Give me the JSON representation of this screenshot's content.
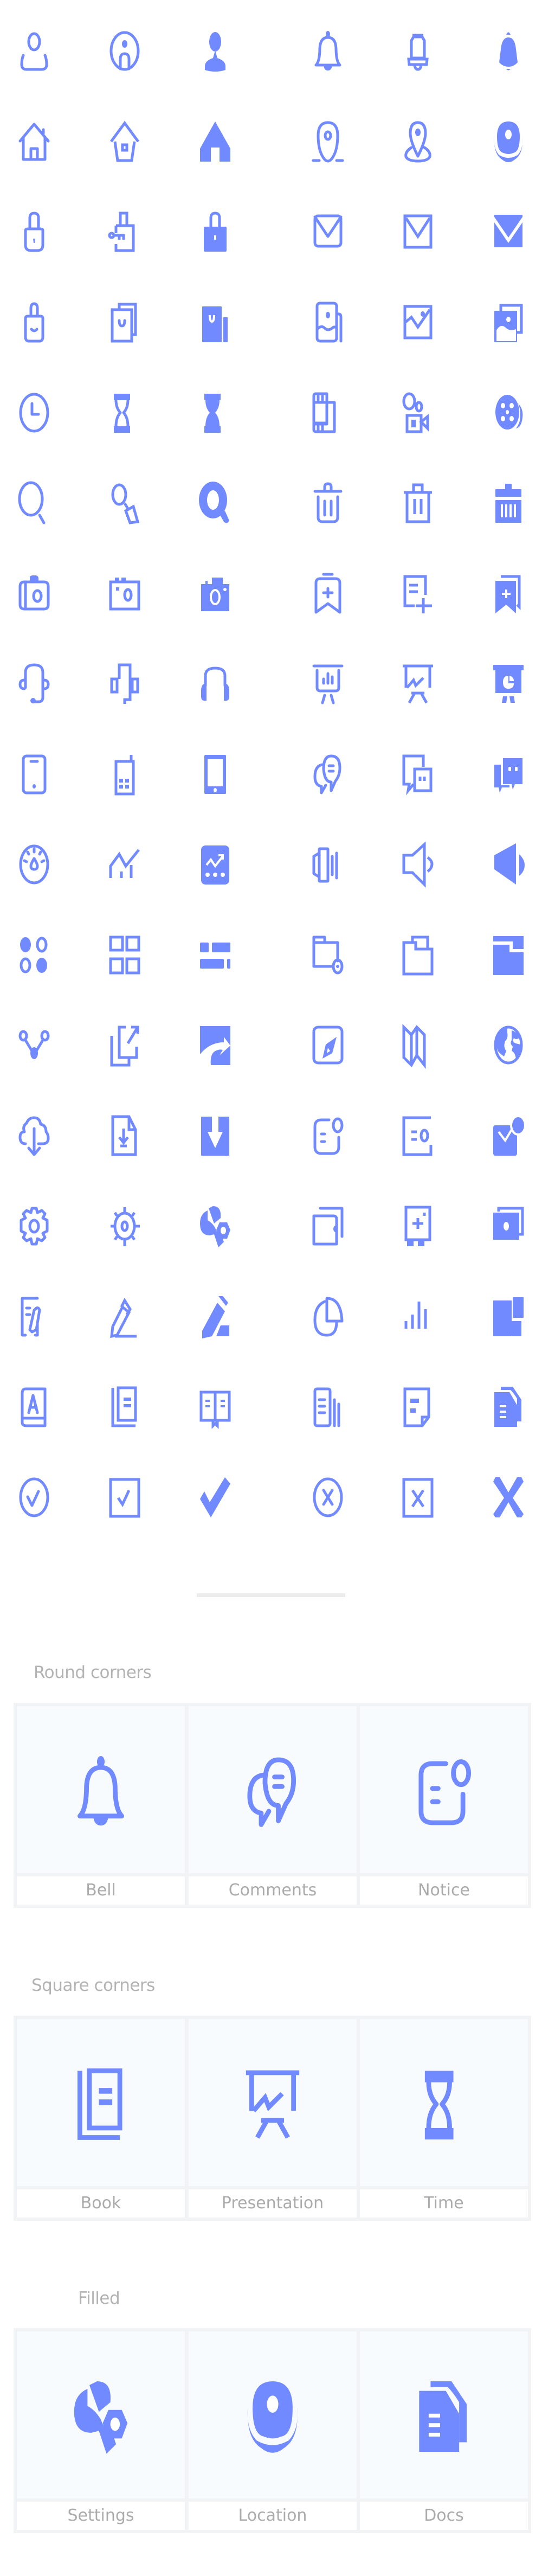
{
  "accent_color": "#728aff",
  "icon_grid": {
    "rows": [
      [
        "user-outline",
        "user-circle",
        "user-filled",
        "bell-round",
        "bell-square",
        "bell-filled"
      ],
      [
        "home-round",
        "home-square",
        "home-filled",
        "location-round",
        "location-square",
        "location-filled"
      ],
      [
        "lock-round",
        "lock-key-square",
        "lock-filled",
        "mail-round",
        "mail-square",
        "mail-filled"
      ],
      [
        "shopping-bag-round",
        "shopping-bag-square",
        "shopping-bag-filled",
        "image-round",
        "image-square",
        "image-filled"
      ],
      [
        "clock-round",
        "hourglass-square",
        "hourglass-filled",
        "film-round",
        "video-camera-square",
        "film-reel-filled"
      ],
      [
        "search-round",
        "search-square",
        "search-filled",
        "trash-round",
        "trash-square",
        "trash-filled"
      ],
      [
        "camera-round",
        "camera-square",
        "camera-filled",
        "bookmark-add-round",
        "note-add-square",
        "bookmark-add-filled"
      ],
      [
        "headset-round",
        "headset-square",
        "headphones-filled",
        "presentation-round",
        "presentation-square",
        "presentation-filled"
      ],
      [
        "smartphone-round",
        "mobile-phone-square",
        "smartphone-filled",
        "comments-round",
        "comments-square",
        "comments-filled"
      ],
      [
        "gauge-round",
        "line-chart-square",
        "analytics-filled",
        "volume-round",
        "volume-square",
        "volume-filled"
      ],
      [
        "dots-grid-round",
        "grid-square",
        "list-filled",
        "folder-settings-round",
        "folder-square",
        "folder-filled"
      ],
      [
        "share-round",
        "external-link-square",
        "share-filled",
        "compass-round",
        "map-square",
        "globe-filled"
      ],
      [
        "cloud-download-round",
        "file-download-square",
        "download-filled",
        "notice-round",
        "notice-square",
        "notice-filled"
      ],
      [
        "settings-round",
        "settings-square",
        "settings-filled",
        "wallet-round",
        "safe-square",
        "money-filled"
      ],
      [
        "edit-document-round",
        "pencil-square",
        "pencil-filled",
        "pie-chart-round",
        "bar-chart-square",
        "blocks-filled"
      ],
      [
        "book-a-round",
        "book-square",
        "open-book-filled",
        "docs-round",
        "document-square",
        "docs-filled"
      ],
      [
        "check-circle-round",
        "check-square",
        "check-filled",
        "close-circle-round",
        "close-square",
        "close-filled"
      ]
    ]
  },
  "sections": [
    {
      "title": "Round corners",
      "items": [
        {
          "label": "Bell",
          "icon": "bell-round"
        },
        {
          "label": "Comments",
          "icon": "comments-round"
        },
        {
          "label": "Notice",
          "icon": "notice-round"
        }
      ]
    },
    {
      "title": "Square corners",
      "items": [
        {
          "label": "Book",
          "icon": "book-square"
        },
        {
          "label": "Presentation",
          "icon": "presentation-square"
        },
        {
          "label": "Time",
          "icon": "hourglass-square"
        }
      ]
    },
    {
      "title": "Filled",
      "items": [
        {
          "label": "Settings",
          "icon": "settings-filled"
        },
        {
          "label": "Location",
          "icon": "location-filled"
        },
        {
          "label": "Docs",
          "icon": "docs-filled"
        }
      ]
    }
  ]
}
